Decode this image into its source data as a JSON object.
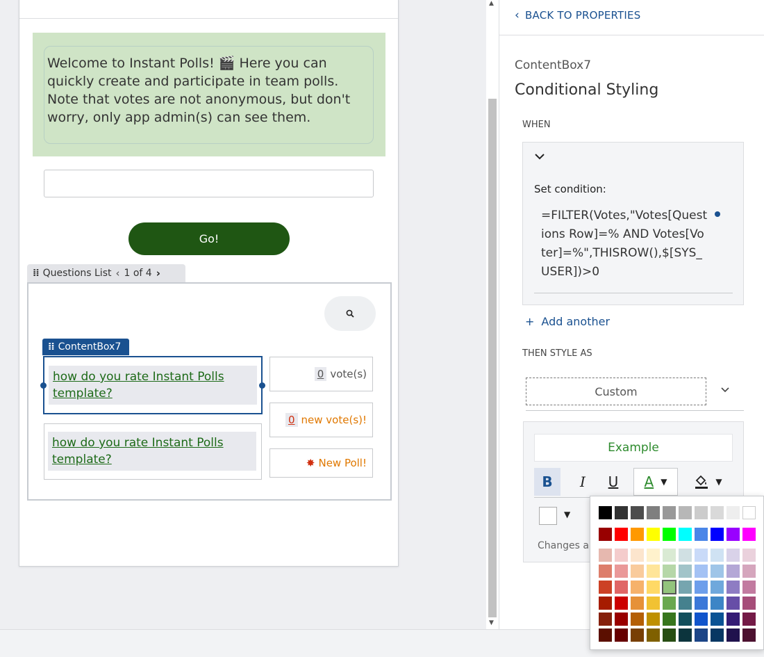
{
  "canvas": {
    "welcome_text": "Welcome to Instant Polls! 🎬 Here you can quickly create and participate in team polls. Note that votes are not anonymous, but don't worry, only app admin(s) can see them.",
    "go_label": "Go!",
    "questions_list": {
      "label": "Questions List",
      "pager": "1 of 4"
    },
    "content_box_tag": "ContentBox7",
    "questions": [
      {
        "text": "how do you rate Instant Polls template?"
      },
      {
        "text": "how do you rate Instant Polls template?"
      }
    ],
    "votes": {
      "count": "0",
      "label": "vote(s)"
    },
    "new_votes": {
      "count": "0",
      "label": "new vote(s)!"
    },
    "new_poll": {
      "label": "New Poll!"
    }
  },
  "panel": {
    "back_label": "BACK TO PROPERTIES",
    "component_name": "ContentBox7",
    "title": "Conditional Styling",
    "when_label": "WHEN",
    "set_condition_label": "Set condition:",
    "formula": "=FILTER(Votes,\"Votes[Questions Row]=% AND Votes[Voter]=%\",THISROW(),$[SYS_USER])>0",
    "add_another_label": "Add another",
    "then_label": "THEN STYLE AS",
    "style_select_value": "Custom",
    "example_label": "Example",
    "format_buttons": {
      "bold": "B",
      "italic": "I",
      "underline": "U",
      "text_color": "A"
    },
    "changes_text": "Changes ap"
  },
  "colors": {
    "accent": "#1a5190",
    "go_button": "#1f5613",
    "welcome_bg": "#cfe4c6",
    "link_green": "#1d6a18",
    "vote_orange": "#e07800",
    "new_poll_red": "#d03010",
    "palette_rows": [
      [
        "#000000",
        "#333333",
        "#4d4d4d",
        "#7f7f7f",
        "#999999",
        "#b7b7b7",
        "#cccccc",
        "#d9d9d9",
        "#eeeeee",
        "#ffffff"
      ],
      [
        "#980000",
        "#ff0000",
        "#ff9900",
        "#ffff00",
        "#00ff00",
        "#00ffff",
        "#4a86e8",
        "#0000ff",
        "#9900ff",
        "#ff00ff"
      ],
      [
        "#e6b8af",
        "#f4cccc",
        "#fce5cd",
        "#fff2cc",
        "#d9ead3",
        "#d0e0e3",
        "#c9daf8",
        "#cfe2f3",
        "#d9d2e9",
        "#ead1dc"
      ],
      [
        "#dd7e6b",
        "#ea9999",
        "#f9cb9c",
        "#ffe599",
        "#b6d7a8",
        "#a2c4c9",
        "#a4c2f4",
        "#9fc5e8",
        "#b4a7d6",
        "#d5a6bd"
      ],
      [
        "#cc4125",
        "#e06666",
        "#f6b26b",
        "#ffd966",
        "#93c47d",
        "#76a5af",
        "#6d9eeb",
        "#6fa8dc",
        "#8e7cc3",
        "#c27ba0"
      ],
      [
        "#a61c00",
        "#cc0000",
        "#e69138",
        "#f1c232",
        "#6aa84f",
        "#45818e",
        "#3c78d8",
        "#3d85c6",
        "#674ea7",
        "#a64d79"
      ],
      [
        "#85200c",
        "#990000",
        "#b45f06",
        "#bf9000",
        "#38761d",
        "#134f5c",
        "#1155cc",
        "#0b5394",
        "#351c75",
        "#741b47"
      ],
      [
        "#5b0f00",
        "#660000",
        "#783f04",
        "#7f6000",
        "#274e13",
        "#0c343d",
        "#1c4587",
        "#073763",
        "#20124d",
        "#4c1130"
      ]
    ],
    "selected_color": "#93c47d"
  }
}
